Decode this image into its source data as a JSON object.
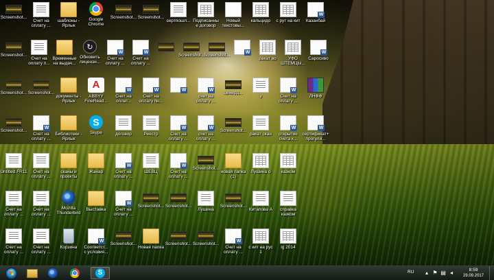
{
  "desktop": {
    "icons": [
      {
        "label": "Screenshot...",
        "type": "shot",
        "icon": "screenshot-icon"
      },
      {
        "label": "Счет на оплату ...",
        "type": "doc",
        "icon": "document-icon"
      },
      {
        "label": "шаблоны - Ярлык",
        "type": "folder",
        "icon": "folder-shortcut-icon"
      },
      {
        "label": "Google Chrome",
        "type": "chrome",
        "icon": "chrome-icon"
      },
      {
        "label": "Screenshot...",
        "type": "shot",
        "icon": "screenshot-icon"
      },
      {
        "label": "Screenshot...",
        "type": "shot",
        "icon": "screenshot-icon"
      },
      {
        "label": "сертпошл...",
        "type": "doc",
        "icon": "document-icon"
      },
      {
        "label": "Подписанные договор на...",
        "type": "table",
        "icon": "table-doc-icon"
      },
      {
        "label": "Новый текстовы...",
        "type": "textfile",
        "icon": "text-file-icon"
      },
      {
        "label": "кальцидо",
        "type": "table",
        "icon": "table-doc-icon"
      },
      {
        "label": "с рут на кит",
        "type": "table",
        "icon": "table-doc-icon"
      },
      {
        "label": "Казанбай",
        "type": "word",
        "icon": "word-doc-icon"
      },
      {
        "label": "Screenshot...",
        "type": "shot",
        "icon": "screenshot-icon"
      },
      {
        "label": "Счет на оплату п...",
        "type": "doc",
        "icon": "document-icon"
      },
      {
        "label": "Временные на выдач...",
        "type": "folder",
        "icon": "folder-shortcut-icon"
      },
      {
        "label": "Обновить лицензи...",
        "type": "update",
        "icon": "update-license-icon"
      },
      {
        "label": "Счет на оплату ...",
        "type": "word",
        "icon": "word-doc-icon"
      },
      {
        "label": "Счет на оплату ...",
        "type": "word",
        "icon": "word-doc-icon"
      },
      {
        "label": "",
        "type": "shot",
        "icon": "screenshot-icon"
      },
      {
        "label": "Screenshot...",
        "type": "shot",
        "icon": "screenshot-icon"
      },
      {
        "label": "Screenshot...",
        "type": "shot",
        "icon": "screenshot-icon"
      },
      {
        "label": "",
        "type": "word",
        "icon": "word-doc-icon"
      },
      {
        "label": "ракат во",
        "type": "table",
        "icon": "table-doc-icon"
      },
      {
        "label": "УФО ШТЕМЦЫ...",
        "type": "table",
        "icon": "table-doc-icon"
      },
      {
        "label": "Саросиво",
        "type": "word",
        "icon": "word-doc-icon"
      },
      {
        "label": "Screenshot...",
        "type": "shot",
        "icon": "screenshot-icon"
      },
      {
        "label": "Screenshot...",
        "type": "shot",
        "icon": "screenshot-icon"
      },
      {
        "label": "документы - Ярлык",
        "type": "folder",
        "icon": "folder-shortcut-icon"
      },
      {
        "label": "ABBYY FineRead...",
        "type": "abbyy",
        "icon": "abbyy-icon"
      },
      {
        "label": "Счет на оплат...",
        "type": "word",
        "icon": "word-doc-icon"
      },
      {
        "label": "Счет на оплату №...",
        "type": "word",
        "icon": "word-doc-icon"
      },
      {
        "label": "",
        "type": "word",
        "icon": "word-doc-icon"
      },
      {
        "label": "счет на оплату ...",
        "type": "word",
        "icon": "word-doc-icon"
      },
      {
        "label": "ценерд...",
        "type": "shot",
        "icon": "screenshot-icon"
      },
      {
        "label": "з",
        "type": "doc",
        "icon": "document-icon"
      },
      {
        "label": "Счет на оплату ...",
        "type": "word",
        "icon": "word-doc-icon"
      },
      {
        "label": "ЛНФФ",
        "type": "archive",
        "icon": "archive-icon"
      },
      {
        "label": "Screenshot...",
        "type": "shot",
        "icon": "screenshot-icon"
      },
      {
        "label": "Счет на оплату ...",
        "type": "word",
        "icon": "word-doc-icon"
      },
      {
        "label": "Библиотеки - Ярлык",
        "type": "folder",
        "icon": "libraries-icon"
      },
      {
        "label": "Skype",
        "type": "skype",
        "icon": "skype-icon"
      },
      {
        "label": "договор",
        "type": "doc",
        "icon": "document-icon"
      },
      {
        "label": "Реестр",
        "type": "doc",
        "icon": "document-icon"
      },
      {
        "label": "Счет на оплату ...",
        "type": "word",
        "icon": "word-doc-icon"
      },
      {
        "label": "счет на оплату ...",
        "type": "word",
        "icon": "word-doc-icon"
      },
      {
        "label": "Screenshot...",
        "type": "shot",
        "icon": "screenshot-icon"
      },
      {
        "label": "ракат скан",
        "type": "doc",
        "icon": "document-icon"
      },
      {
        "label": "открытие счета к...",
        "type": "word",
        "icon": "word-doc-icon"
      },
      {
        "label": "сертификат+прогули...",
        "type": "word",
        "icon": "word-doc-icon"
      },
      {
        "label": "Untitled.FR11",
        "type": "doc",
        "icon": "document-icon"
      },
      {
        "label": "Счет на оплату ...",
        "type": "doc",
        "icon": "document-icon"
      },
      {
        "label": "сканы и проекты",
        "type": "folder",
        "icon": "folder-icon"
      },
      {
        "label": "Жанар",
        "type": "folder",
        "icon": "folder-icon"
      },
      {
        "label": "Счет на оплату ...",
        "type": "word",
        "icon": "word-doc-icon"
      },
      {
        "label": "ШЕВЦ",
        "type": "doc",
        "icon": "document-icon"
      },
      {
        "label": "Счет на оплату ...",
        "type": "word",
        "icon": "word-doc-icon"
      },
      {
        "label": "Screenshot...",
        "type": "shot",
        "icon": "screenshot-icon"
      },
      {
        "label": "новая папка (1)",
        "type": "folder",
        "icon": "folder-icon"
      },
      {
        "label": "Лушина о",
        "type": "table",
        "icon": "table-doc-icon"
      },
      {
        "label": "казком",
        "type": "table",
        "icon": "table-doc-icon"
      },
      {
        "label": "Счет на оплату ...",
        "type": "doc",
        "icon": "document-icon"
      },
      {
        "label": "Счет на оплату ...",
        "type": "doc",
        "icon": "document-icon"
      },
      {
        "label": "Mozilla Thunderbird",
        "type": "thunder",
        "icon": "thunderbird-icon"
      },
      {
        "label": "Выставка",
        "type": "folder",
        "icon": "folder-icon"
      },
      {
        "label": "Счет на оплату ...",
        "type": "word",
        "icon": "word-doc-icon"
      },
      {
        "label": "Screenshot...",
        "type": "shot",
        "icon": "screenshot-icon"
      },
      {
        "label": "Screenshot...",
        "type": "shot",
        "icon": "screenshot-icon"
      },
      {
        "label": "Лушина",
        "type": "doc",
        "icon": "document-icon"
      },
      {
        "label": "Screenshot...",
        "type": "shot",
        "icon": "screenshot-icon"
      },
      {
        "label": "Китапова А",
        "type": "doc",
        "icon": "document-icon"
      },
      {
        "label": "справка казком",
        "type": "doc",
        "icon": "document-icon"
      },
      {
        "label": "Счет на оплату ...",
        "type": "doc",
        "icon": "document-icon"
      },
      {
        "label": "Счет на оплату ...",
        "type": "doc",
        "icon": "document-icon"
      },
      {
        "label": "Корзина",
        "type": "trash",
        "icon": "recycle-bin-icon"
      },
      {
        "label": "Соответст... с условия...",
        "type": "word",
        "icon": "word-doc-icon"
      },
      {
        "label": "Screenshot...",
        "type": "shot",
        "icon": "screenshot-icon"
      },
      {
        "label": "Новая папка",
        "type": "folder",
        "icon": "folder-icon"
      },
      {
        "label": "Screenshot...",
        "type": "shot",
        "icon": "screenshot-icon"
      },
      {
        "label": "Screenshot...",
        "type": "shot",
        "icon": "screenshot-icon"
      },
      {
        "label": "Счет на оплату ...",
        "type": "word",
        "icon": "word-doc-icon"
      },
      {
        "label": "с кит на рус 1",
        "type": "table",
        "icon": "table-doc-icon"
      },
      {
        "label": "ig 2014",
        "type": "table",
        "icon": "table-doc-icon"
      }
    ]
  },
  "taskbar": {
    "language": "RU",
    "time": "8:59",
    "date": "29.09.2017",
    "pinned": [
      {
        "name": "explorer",
        "icon": "file-explorer-icon"
      },
      {
        "name": "thunderbird",
        "icon": "thunderbird-icon"
      },
      {
        "name": "chrome",
        "icon": "chrome-icon"
      },
      {
        "name": "skype",
        "icon": "skype-icon"
      }
    ]
  }
}
